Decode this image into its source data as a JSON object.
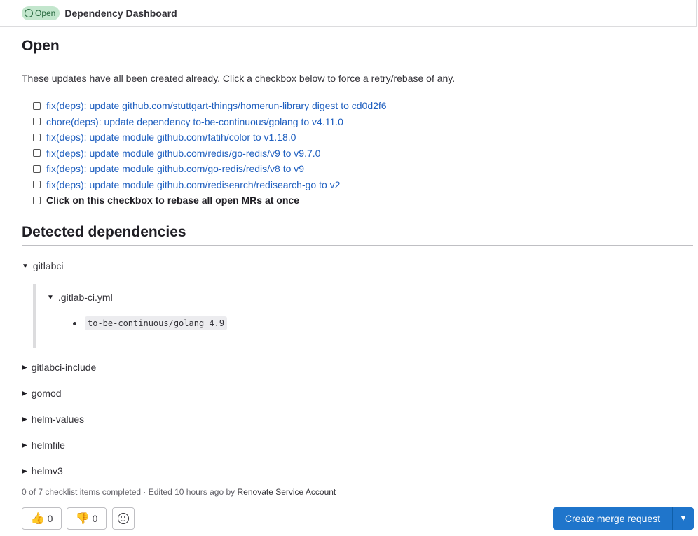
{
  "header": {
    "status_badge": "Open",
    "title": "Dependency Dashboard"
  },
  "open_section": {
    "heading": "Open",
    "intro": "These updates have all been created already. Click a checkbox below to force a retry/rebase of any.",
    "items": [
      "fix(deps): update github.com/stuttgart-things/homerun-library digest to cd0d2f6",
      "chore(deps): update dependency to-be-continuous/golang to v4.11.0",
      "fix(deps): update module github.com/fatih/color to v1.18.0",
      "fix(deps): update module github.com/redis/go-redis/v9 to v9.7.0",
      "fix(deps): update module github.com/go-redis/redis/v8 to v9",
      "fix(deps): update module github.com/redisearch/redisearch-go to v2"
    ],
    "rebase_all": "Click on this checkbox to rebase all open MRs at once"
  },
  "detected": {
    "heading": "Detected dependencies",
    "gitlabci": {
      "label": "gitlabci",
      "file": ".gitlab-ci.yml",
      "dependency": "to-be-continuous/golang 4.9"
    },
    "collapsed": [
      "gitlabci-include",
      "gomod",
      "helm-values",
      "helmfile",
      "helmv3"
    ]
  },
  "footer": {
    "meta": "0 of 7 checklist items completed · Edited 10 hours ago by",
    "author": "Renovate Service Account",
    "thumbs_up_count": "0",
    "thumbs_down_count": "0",
    "merge_button": "Create merge request"
  }
}
